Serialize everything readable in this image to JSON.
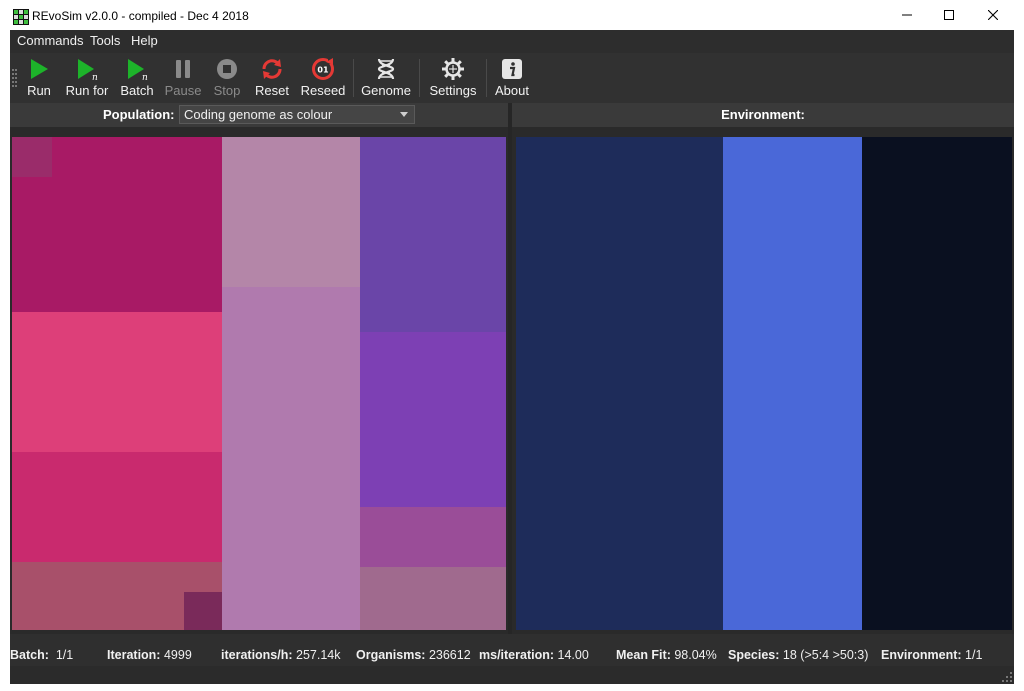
{
  "window": {
    "title": "REvoSim v2.0.0 - compiled - Dec  4 2018",
    "icon": "app-grid-icon"
  },
  "menu": {
    "items": [
      "Commands",
      "Tools",
      "Help"
    ]
  },
  "toolbar": {
    "run": "Run",
    "run_for": "Run for",
    "batch": "Batch",
    "pause": "Pause",
    "stop": "Stop",
    "reset": "Reset",
    "reseed": "Reseed",
    "reseed_badge": "01",
    "genome": "Genome",
    "settings": "Settings",
    "about": "About",
    "subscript": "n"
  },
  "population": {
    "label": "Population:",
    "display_mode": "Coding genome as colour"
  },
  "environment": {
    "label": "Environment:"
  },
  "status": {
    "batch_label": "Batch:",
    "batch_value": "1/1",
    "iteration_label": "Iteration:",
    "iteration_value": "4999",
    "iph_label": "iterations/h:",
    "iph_value": "257.14k",
    "organisms_label": "Organisms:",
    "organisms_value": "236612",
    "ms_label": "ms/iteration:",
    "ms_value": "14.00",
    "fit_label": "Mean Fit:",
    "fit_value": "98.04%",
    "species_label": "Species:",
    "species_value": "18 (>5:4 >50:3)",
    "env_label": "Environment:",
    "env_value": "1/1"
  },
  "colors": {
    "play_green": "#1db32a",
    "reset_red": "#e53935",
    "population_magenta": "#b51a6c",
    "population_pink": "#e0407a",
    "population_mauve": "#b07aae",
    "population_purple": "#7a3fb0",
    "environment_navy": "#1e2c5a",
    "environment_blue": "#4a68d8",
    "environment_black": "#0a1020"
  }
}
